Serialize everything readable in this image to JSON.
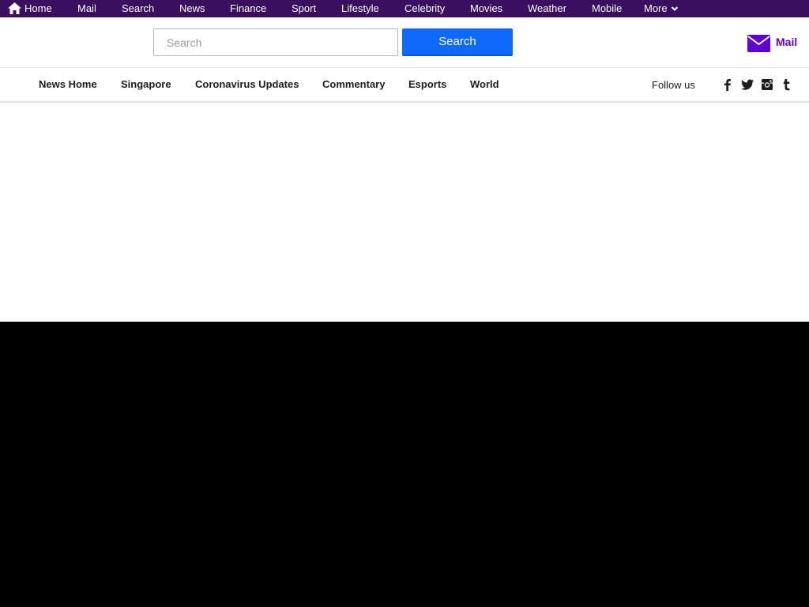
{
  "topbar": {
    "items": [
      {
        "label": "Home",
        "icon": "home-icon"
      },
      {
        "label": "Mail"
      },
      {
        "label": "Search"
      },
      {
        "label": "News"
      },
      {
        "label": "Finance"
      },
      {
        "label": "Sport"
      },
      {
        "label": "Lifestyle"
      },
      {
        "label": "Celebrity"
      },
      {
        "label": "Movies"
      },
      {
        "label": "Weather"
      },
      {
        "label": "Mobile"
      },
      {
        "label": "More",
        "icon": "chevron-down-icon"
      }
    ],
    "background": "#3b0f60"
  },
  "header": {
    "search_placeholder": "Search",
    "search_value": "",
    "search_button_label": "Search",
    "mail_label": "Mail",
    "mail_icon": "envelope-icon",
    "accent": "#5f01d1",
    "button_color": "#0f69ff"
  },
  "newsnav": {
    "items": [
      {
        "label": "News Home"
      },
      {
        "label": "Singapore"
      },
      {
        "label": "Coronavirus Updates"
      },
      {
        "label": "Commentary"
      },
      {
        "label": "Esports"
      },
      {
        "label": "World"
      }
    ],
    "follow_label": "Follow us",
    "social": [
      "facebook-icon",
      "twitter-icon",
      "instagram-icon",
      "tumblr-icon"
    ]
  }
}
